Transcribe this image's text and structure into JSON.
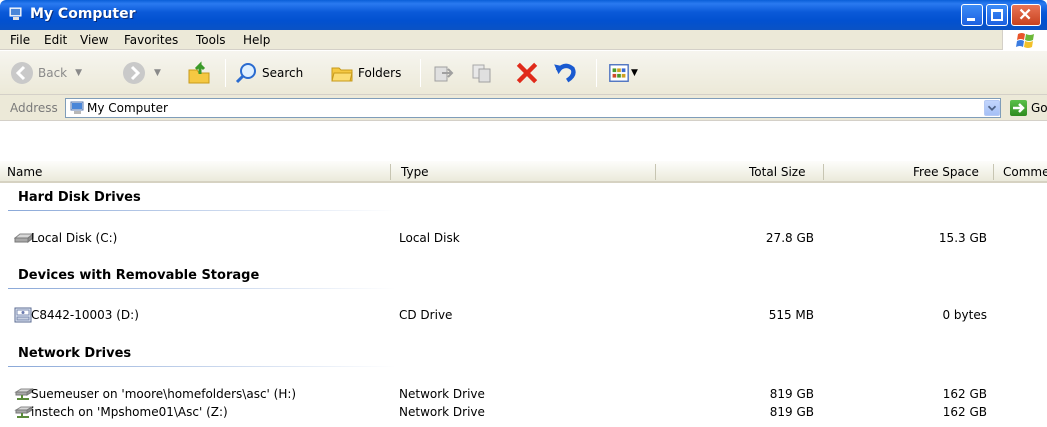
{
  "window": {
    "title": "My Computer"
  },
  "menu": [
    "File",
    "Edit",
    "View",
    "Favorites",
    "Tools",
    "Help"
  ],
  "toolbar": {
    "back_label": "Back",
    "search_label": "Search",
    "folders_label": "Folders"
  },
  "address": {
    "label": "Address",
    "value": "My Computer",
    "go_label": "Go"
  },
  "columns": {
    "name": "Name",
    "type": "Type",
    "total": "Total Size",
    "free": "Free Space",
    "comments": "Comme"
  },
  "groups": [
    {
      "title": "Hard Disk Drives",
      "items": [
        {
          "name": "Local Disk (C:)",
          "type": "Local Disk",
          "total": "27.8 GB",
          "free": "15.3 GB",
          "icon": "hard-disk-icon"
        }
      ]
    },
    {
      "title": "Devices with Removable Storage",
      "items": [
        {
          "name": "C8442-10003 (D:)",
          "type": "CD Drive",
          "total": "515 MB",
          "free": "0 bytes",
          "icon": "cd-drive-icon"
        }
      ]
    },
    {
      "title": "Network Drives",
      "items": [
        {
          "name": "Suemeuser on 'moore\\homefolders\\asc' (H:)",
          "type": "Network Drive",
          "total": "819 GB",
          "free": "162 GB",
          "icon": "network-drive-icon"
        },
        {
          "name": "instech on 'Mpshome01\\Asc' (Z:)",
          "type": "Network Drive",
          "total": "819 GB",
          "free": "162 GB",
          "icon": "network-drive-icon"
        }
      ]
    }
  ]
}
